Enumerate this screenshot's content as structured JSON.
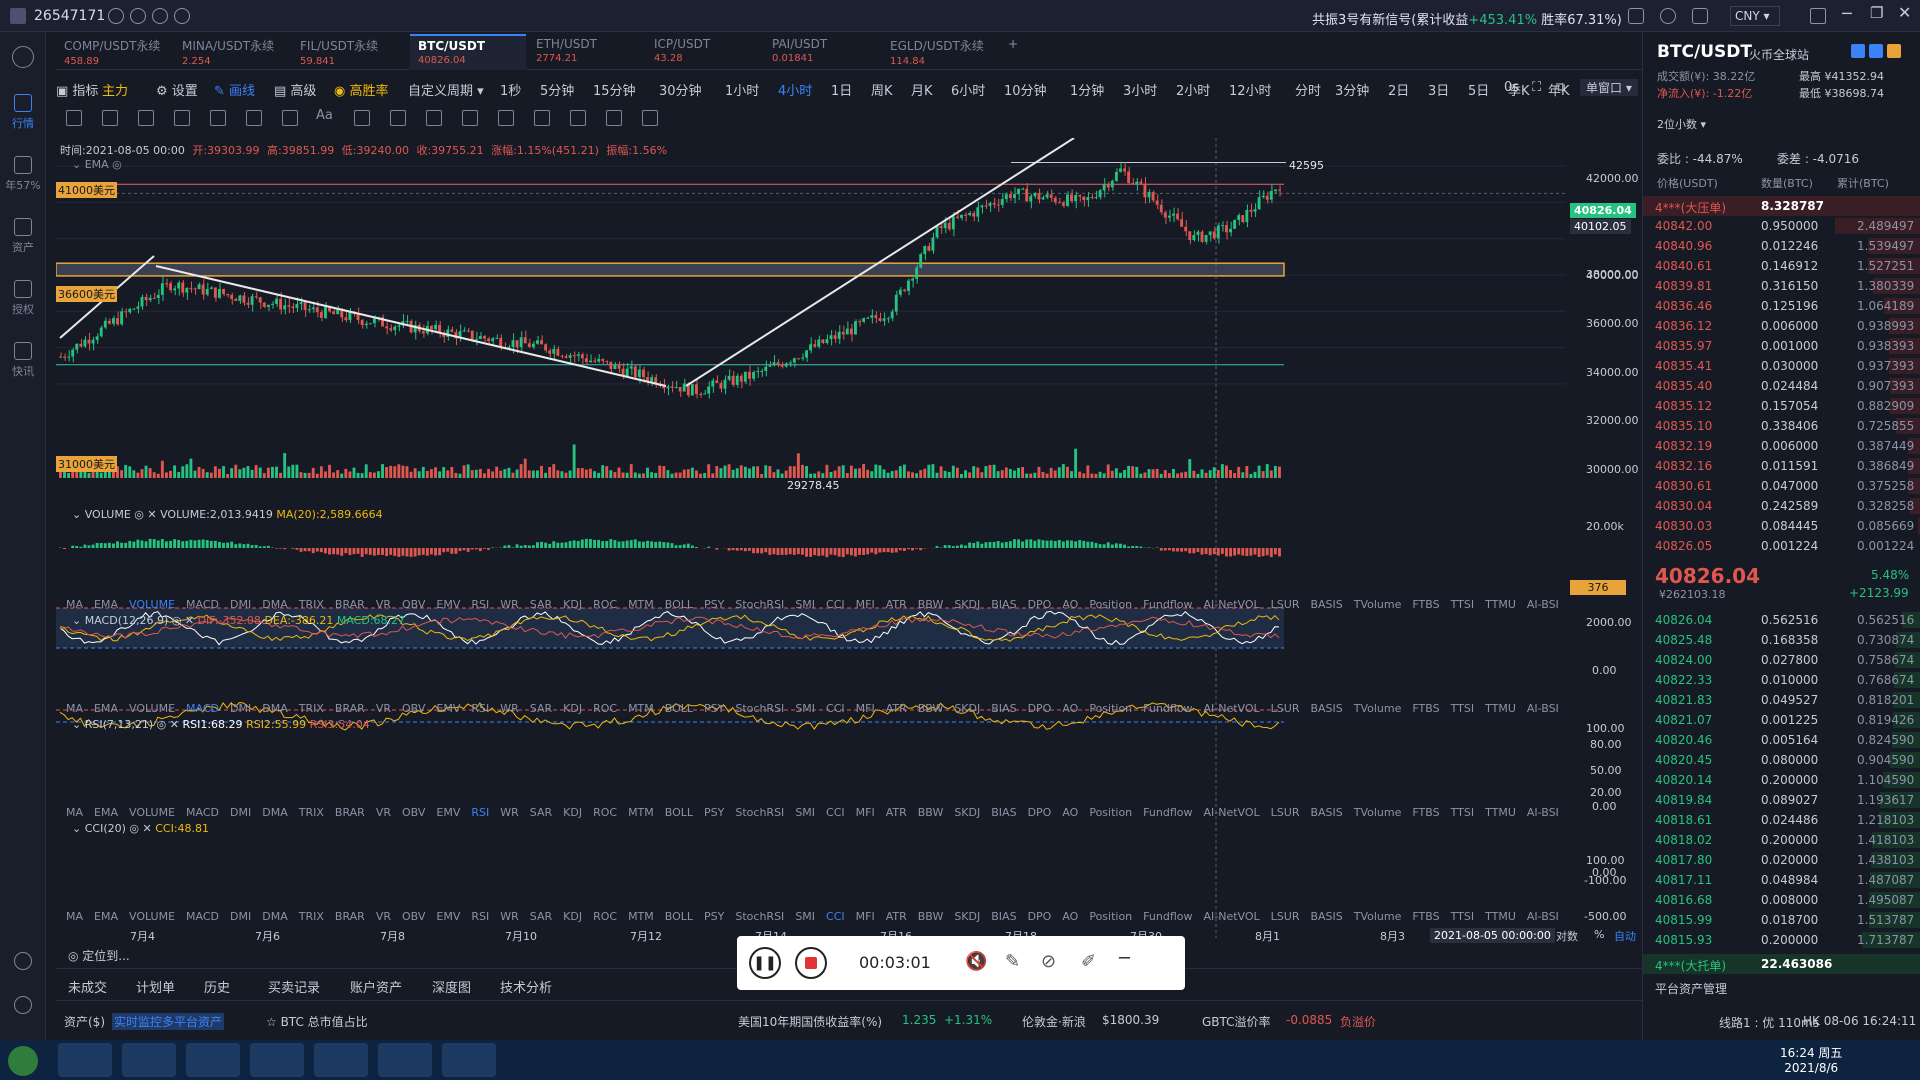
{
  "topbar": {
    "user_id": "26547171",
    "signal_prefix": "共振3号有新信号(累计收益",
    "signal_gain": "+453.41%",
    "signal_suffix": "胜率67.31%)",
    "currency": "CNY"
  },
  "tabs": [
    {
      "name": "COMP/USDT永续",
      "price": "458.89"
    },
    {
      "name": "MINA/USDT永续",
      "price": "2.254"
    },
    {
      "name": "FIL/USDT永续",
      "price": "59.841"
    },
    {
      "name": "BTC/USDT",
      "price": "40826.04"
    },
    {
      "name": "ETH/USDT",
      "price": "2774.21"
    },
    {
      "name": "ICP/USDT",
      "price": "43.28"
    },
    {
      "name": "PAI/USDT",
      "price": "0.01841"
    },
    {
      "name": "EGLD/USDT永续",
      "price": "114.84"
    }
  ],
  "sidebar": [
    {
      "label": "行情"
    },
    {
      "label": "年57%"
    },
    {
      "label": "资产"
    },
    {
      "label": "授权"
    },
    {
      "label": "快讯"
    }
  ],
  "toolbar": {
    "indicator": "指标",
    "main": "主力",
    "settings": "设置",
    "draw": "画线",
    "advanced": "高级",
    "winrate": "高胜率",
    "custom_period": "自定义周期",
    "periods": [
      "1秒",
      "5分钟",
      "15分钟",
      "30分钟",
      "1小时",
      "4小时",
      "1日",
      "周K",
      "月K",
      "6小时",
      "10分钟",
      "1分钟",
      "3小时",
      "2小时",
      "12小时",
      "分时",
      "3分钟",
      "2日",
      "3日",
      "5日",
      "季K",
      "年K"
    ],
    "active_period": "4小时",
    "right_zero": "0s",
    "window_mode": "单窗口"
  },
  "ohlc": {
    "time": "时间:2021-08-05 00:00",
    "open": "开:39303.99",
    "high": "高:39851.99",
    "low": "低:39240.00",
    "close": "收:39755.21",
    "change": "涨幅:1.15%(451.21)",
    "amp": "振幅:1.56%"
  },
  "ema_label": "EMA",
  "levels": [
    {
      "label": "41000美元",
      "price": 41000
    },
    {
      "label": "36600美元",
      "price": 36600
    },
    {
      "label": "31000美元",
      "price": 31000
    }
  ],
  "annotations": {
    "high": "42595",
    "low": "29278.45"
  },
  "price_axis": [
    "42000.00",
    "40000.00",
    "38000.00",
    "36000.00",
    "34000.00",
    "32000.00",
    "30000.00"
  ],
  "price_tags": {
    "last": "40826.04",
    "prev": "40102.05"
  },
  "volume": {
    "title": "VOLUME",
    "value": "VOLUME:2,013.9419",
    "ma": "MA(20):2,589.6664",
    "axis_top": "20.00k",
    "tag": "376"
  },
  "macd": {
    "title": "MACD(12,26,9)",
    "dif": "DIF:-352.08",
    "dea": "DEA:-386.21",
    "macd": "MACD:68.27",
    "axis": [
      "2000.00",
      "0.00"
    ]
  },
  "rsi": {
    "title": "RSI(7,13,21)",
    "r1": "RSI1:68.29",
    "r2": "RSI2:55.99",
    "r3": "RSI3:54.04",
    "axis": [
      "100.00",
      "80.00",
      "50.00",
      "20.00",
      "0.00"
    ]
  },
  "cci": {
    "title": "CCI(20)",
    "value": "CCI:48.81",
    "axis": [
      "100.00",
      "0.00",
      "-100.00",
      "-500.00"
    ]
  },
  "indicator_list": [
    "MA",
    "EMA",
    "VOLUME",
    "MACD",
    "DMI",
    "DMA",
    "TRIX",
    "BRAR",
    "VR",
    "OBV",
    "EMV",
    "RSI",
    "WR",
    "SAR",
    "KDJ",
    "ROC",
    "MTM",
    "BOLL",
    "PSY",
    "StochRSI",
    "SMI",
    "CCI",
    "MFI",
    "ATR",
    "BBW",
    "SKDJ",
    "BIAS",
    "DPO",
    "AO",
    "Position",
    "Fundflow",
    "AI-NetVOL",
    "LSUR",
    "BASIS",
    "TVolume",
    "FTBS",
    "TTSI",
    "TTMU",
    "AI-BSI"
  ],
  "date_axis": [
    "7月4",
    "7月6",
    "7月8",
    "7月10",
    "7月12",
    "7月14",
    "7月16",
    "7月18",
    "7月30",
    "8月1",
    "8月3"
  ],
  "cursor_date": "2021-08-05 00:00:00",
  "axis_opts": [
    "对数",
    "%",
    "自动"
  ],
  "locate": "定位到...",
  "bottom_tabs": [
    "未成交",
    "计划单",
    "历史",
    "买卖记录",
    "账户资产",
    "深度图",
    "技术分析"
  ],
  "bottom_bar": {
    "assets": "资产($)",
    "monitor": "实时监控多平台资产",
    "dominance": "BTC 总市值占比",
    "bond_label": "美国10年期国债收益率(%)",
    "bond_value": "1.235",
    "bond_change": "+1.31%",
    "gold_label": "伦敦金·新浪",
    "gold_value": "$1800.39",
    "gbtc_label": "GBTC溢价率",
    "gbtc_value": "-0.0885",
    "gbtc_note": "负溢价"
  },
  "recorder": {
    "time": "00:03:01"
  },
  "orderbook": {
    "pair": "BTC/USDT",
    "exchange": "火币全球站",
    "turnover": "成交额(¥): 38.22亿",
    "netflow": "净流入(¥): -1.22亿",
    "high": "最高 ¥41352.94",
    "low": "最低 ¥38698.74",
    "decimals": "2位小数",
    "ratio": "委比 : -44.87%",
    "diff": "委差 : -4.0716",
    "headers": [
      "价格(USDT)",
      "数量(BTC)",
      "累计(BTC)"
    ],
    "big_ask": {
      "label": "4***(大压单)",
      "qty": "8.328787"
    },
    "asks": [
      [
        "40842.00",
        "0.950000",
        "2.489497"
      ],
      [
        "40840.96",
        "0.012246",
        "1.539497"
      ],
      [
        "40840.61",
        "0.146912",
        "1.527251"
      ],
      [
        "40839.81",
        "0.316150",
        "1.380339"
      ],
      [
        "40836.46",
        "0.125196",
        "1.064189"
      ],
      [
        "40836.12",
        "0.006000",
        "0.938993"
      ],
      [
        "40835.97",
        "0.001000",
        "0.938393"
      ],
      [
        "40835.41",
        "0.030000",
        "0.937393"
      ],
      [
        "40835.40",
        "0.024484",
        "0.907393"
      ],
      [
        "40835.12",
        "0.157054",
        "0.882909"
      ],
      [
        "40835.10",
        "0.338406",
        "0.725855"
      ],
      [
        "40832.19",
        "0.006000",
        "0.387449"
      ],
      [
        "40832.16",
        "0.011591",
        "0.386849"
      ],
      [
        "40830.61",
        "0.047000",
        "0.375258"
      ],
      [
        "40830.04",
        "0.242589",
        "0.328258"
      ],
      [
        "40830.03",
        "0.084445",
        "0.085669"
      ],
      [
        "40826.05",
        "0.001224",
        "0.001224"
      ]
    ],
    "last_price": "40826.04",
    "last_cny": "¥262103.18",
    "pct": "5.48%",
    "chg": "+2123.99",
    "bids": [
      [
        "40826.04",
        "0.562516",
        "0.562516"
      ],
      [
        "40825.48",
        "0.168358",
        "0.730874"
      ],
      [
        "40824.00",
        "0.027800",
        "0.758674"
      ],
      [
        "40822.33",
        "0.010000",
        "0.768674"
      ],
      [
        "40821.83",
        "0.049527",
        "0.818201"
      ],
      [
        "40821.07",
        "0.001225",
        "0.819426"
      ],
      [
        "40820.46",
        "0.005164",
        "0.824590"
      ],
      [
        "40820.45",
        "0.080000",
        "0.904590"
      ],
      [
        "40820.14",
        "0.200000",
        "1.104590"
      ],
      [
        "40819.84",
        "0.089027",
        "1.193617"
      ],
      [
        "40818.61",
        "0.024486",
        "1.218103"
      ],
      [
        "40818.02",
        "0.200000",
        "1.418103"
      ],
      [
        "40817.80",
        "0.020000",
        "1.438103"
      ],
      [
        "40817.11",
        "0.048984",
        "1.487087"
      ],
      [
        "40816.68",
        "0.008000",
        "1.495087"
      ],
      [
        "40815.99",
        "0.018700",
        "1.513787"
      ],
      [
        "40815.93",
        "0.200000",
        "1.713787"
      ]
    ],
    "big_bid": {
      "label": "4***(大托单)",
      "qty": "22.463086"
    },
    "asset_mgmt": "平台资产管理",
    "network": "线路1 : 优 110ms",
    "hk_time": "HK 08-06 16:24:11"
  },
  "taskbar": {
    "time": "16:24 周五",
    "date": "2021/8/6"
  },
  "colors": {
    "up": "#26c281",
    "down": "#e0574f",
    "accent": "#3b82f6",
    "level_line": "#e4667a",
    "band": "#e8a43a"
  }
}
